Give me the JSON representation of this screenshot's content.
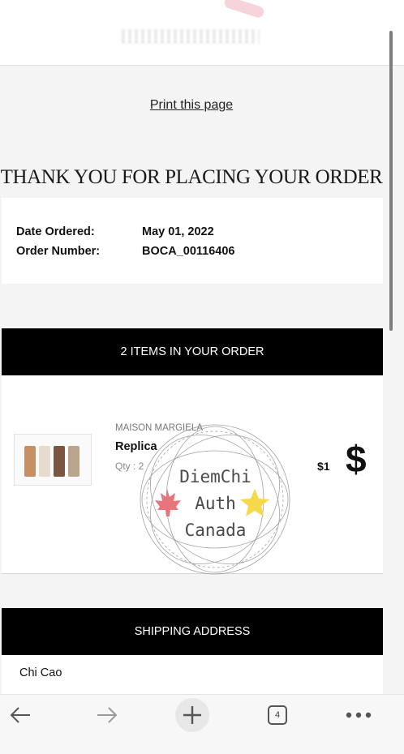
{
  "header": {},
  "print_link": "Print this page",
  "heading": "THANK YOU FOR PLACING YOUR ORDER",
  "order_info": {
    "date_label": "Date Ordered:",
    "date_value": "May 01, 2022",
    "number_label": "Order Number:",
    "number_value": "BOCA_00116406"
  },
  "items_header": "2 ITEMS IN YOUR ORDER",
  "item": {
    "brand": "MAISON MARGIELA",
    "name": "Replica",
    "qty": "Qty : 2",
    "price": "$1",
    "overlay_symbol": "$"
  },
  "watermark": {
    "line1": "DiemChi",
    "line2": "Auth",
    "line3": "Canada"
  },
  "shipping_header": "SHIPPING ADDRESS",
  "shipping": {
    "name": "Chi Cao"
  },
  "navbar": {
    "tab_count": "4"
  },
  "colors": {
    "header_bar": "#000000",
    "leaf": "#e8747c",
    "star": "#f5d94a"
  }
}
